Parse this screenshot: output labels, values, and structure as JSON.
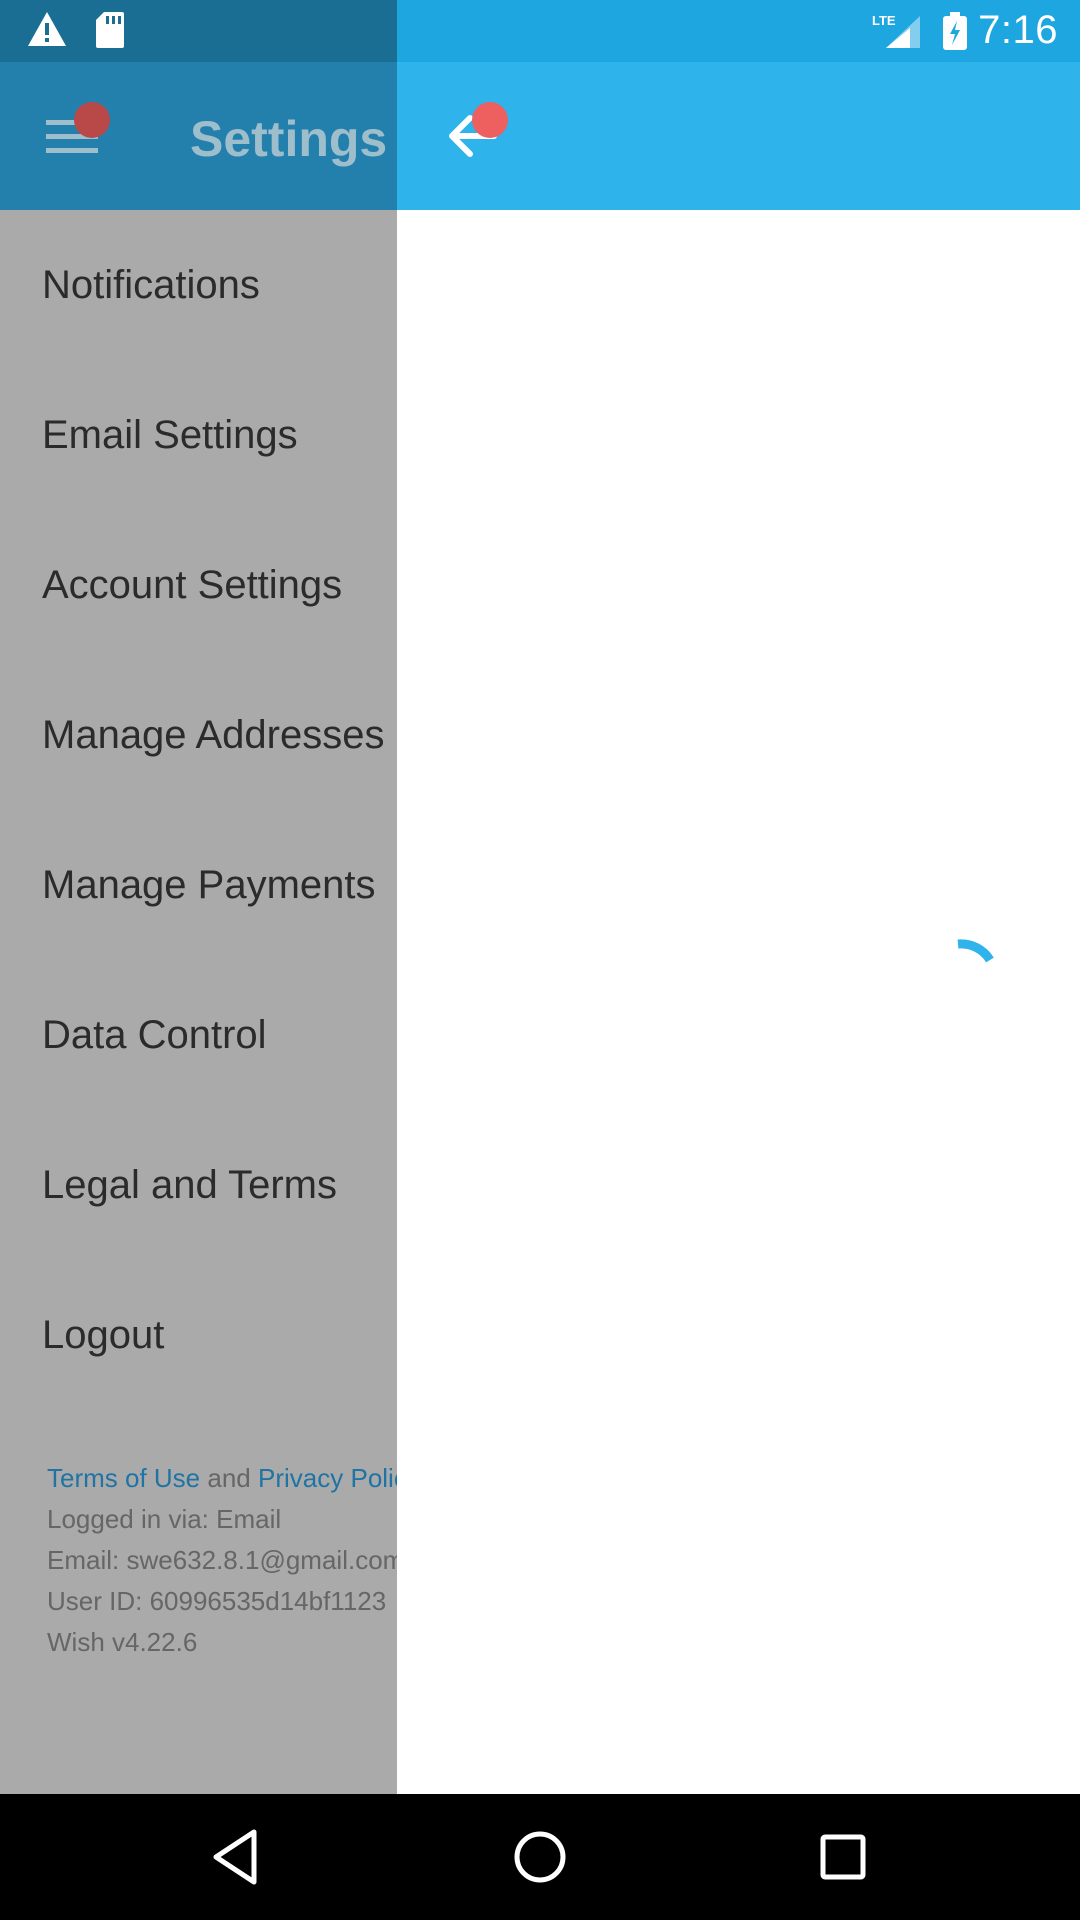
{
  "status_bar": {
    "time": "7:16",
    "network_label": "LTE",
    "icons": [
      "warning-icon",
      "sd-card-icon",
      "lte-signal-icon",
      "battery-charging-icon"
    ],
    "background": "#1ea6e0"
  },
  "app_bar": {
    "back_icon": "arrow-back-icon",
    "background": "#2eb3ea"
  },
  "drawer": {
    "title": "Settings",
    "menu_icon": "hamburger-menu-icon",
    "items": [
      {
        "label": "Notifications"
      },
      {
        "label": "Email Settings"
      },
      {
        "label": "Account Settings"
      },
      {
        "label": "Manage Addresses"
      },
      {
        "label": "Manage Payments"
      },
      {
        "label": "Data Control"
      },
      {
        "label": "Legal and Terms"
      },
      {
        "label": "Logout"
      }
    ],
    "footer": {
      "terms_link": "Terms of Use",
      "and_text": "and",
      "privacy_link": "Privacy Policy",
      "logged_in_via": "Logged in via: Email",
      "email": "Email: swe632.8.1@gmail.com",
      "user_id": "User ID: 60996535d14bf1123",
      "version": "Wish v4.22.6"
    }
  },
  "content": {
    "spinner_icon": "loading-spinner-icon"
  },
  "nav_bar": {
    "icons": [
      "nav-back-icon",
      "nav-home-icon",
      "nav-recents-icon"
    ]
  },
  "colors": {
    "accent": "#2eb3ea",
    "scrim": "#aaaaaa",
    "link": "#1f74a5",
    "notification_dot": "#ee5f5f"
  }
}
